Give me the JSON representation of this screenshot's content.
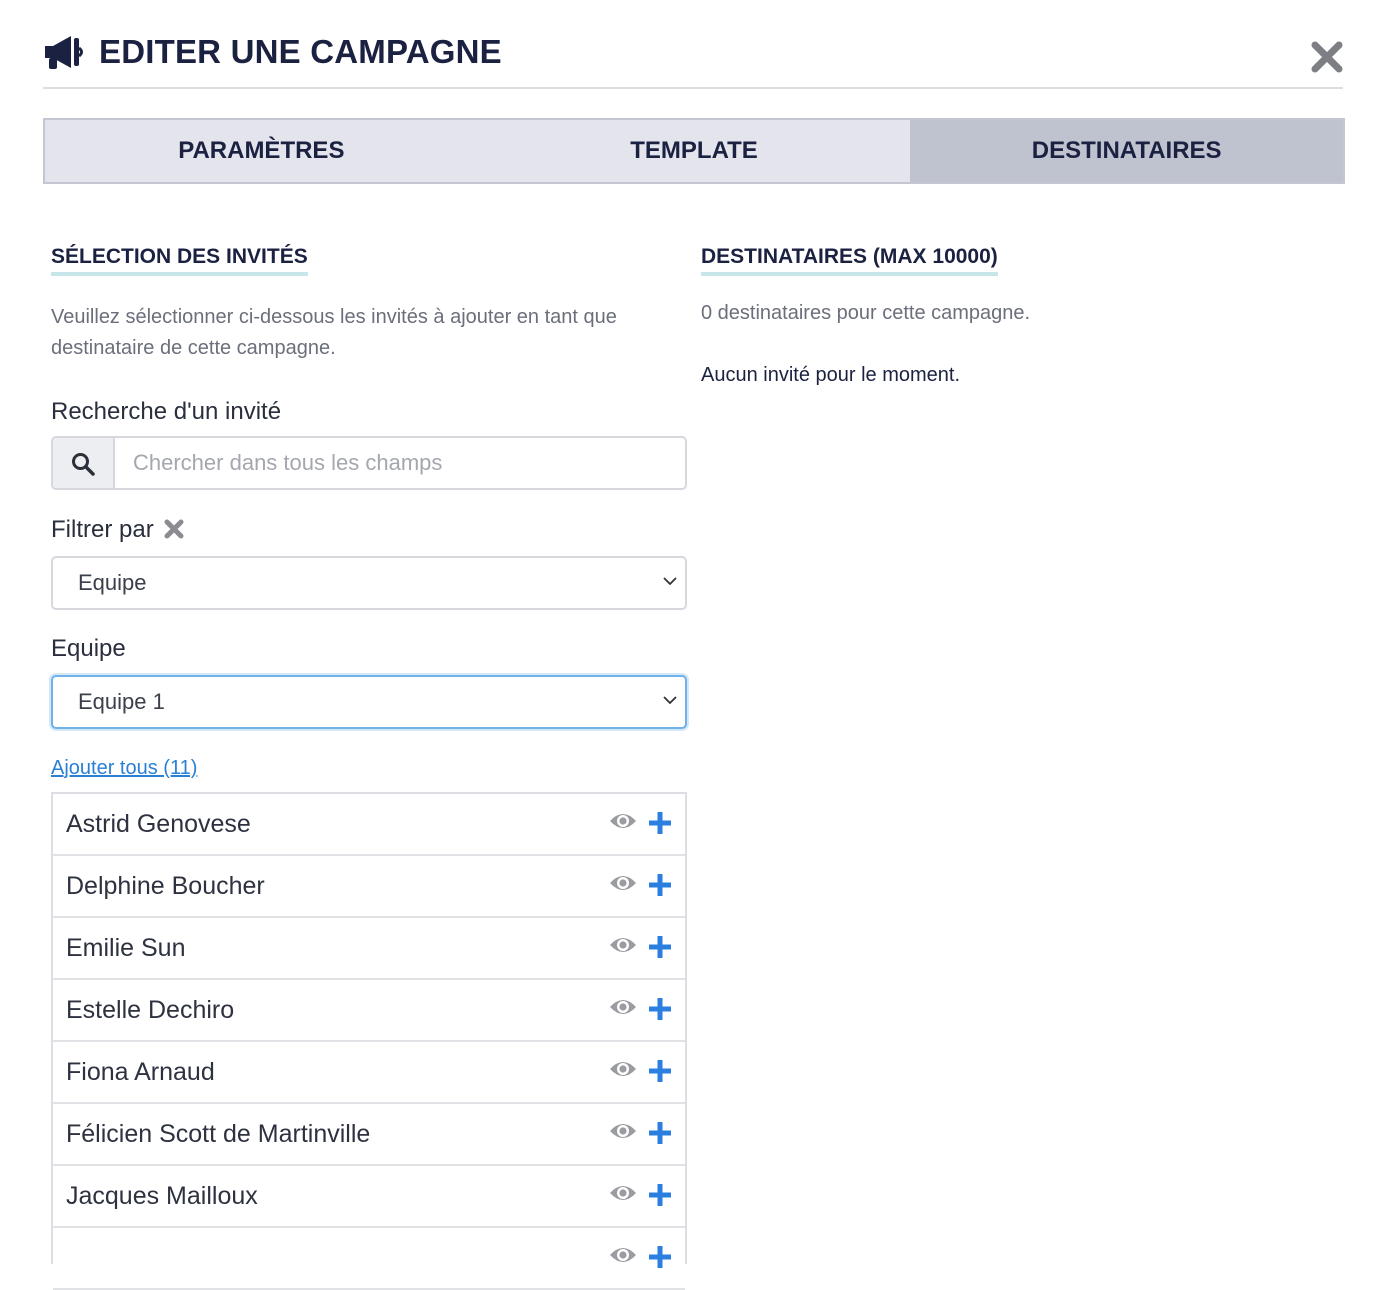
{
  "header": {
    "title": "EDITER UNE CAMPAGNE",
    "icon": "megaphone-icon",
    "close_icon": "close-icon"
  },
  "tabs": [
    {
      "label": "PARAMÈTRES",
      "active": false
    },
    {
      "label": "TEMPLATE",
      "active": false
    },
    {
      "label": "DESTINATAIRES",
      "active": true
    }
  ],
  "left": {
    "section_title": "SÉLECTION DES INVITÉS",
    "description": "Veuillez sélectionner ci-dessous les invités à ajouter en tant que destinataire de cette campagne.",
    "search_label": "Recherche d'un invité",
    "search_placeholder": "Chercher dans tous les champs",
    "search_value": "",
    "filter_label": "Filtrer par",
    "filter_select": "Equipe",
    "team_label": "Equipe",
    "team_select": "Equipe 1",
    "add_all": "Ajouter tous (11)",
    "guests": [
      "Astrid Genovese",
      "Delphine Boucher",
      "Emilie Sun",
      "Estelle Dechiro",
      "Fiona Arnaud",
      "Félicien Scott de Martinville",
      "Jacques Mailloux",
      ""
    ]
  },
  "right": {
    "section_title": "DESTINATAIRES (MAX 10000)",
    "count_text": "0 destinataires pour cette campagne.",
    "empty_text": "Aucun invité pour le moment."
  },
  "colors": {
    "accent": "#2a80d5",
    "title": "#1b2140",
    "tab_active": "#bfc2cf",
    "tab_bg": "#e3e4ec",
    "underline": "#c7e6ea"
  }
}
